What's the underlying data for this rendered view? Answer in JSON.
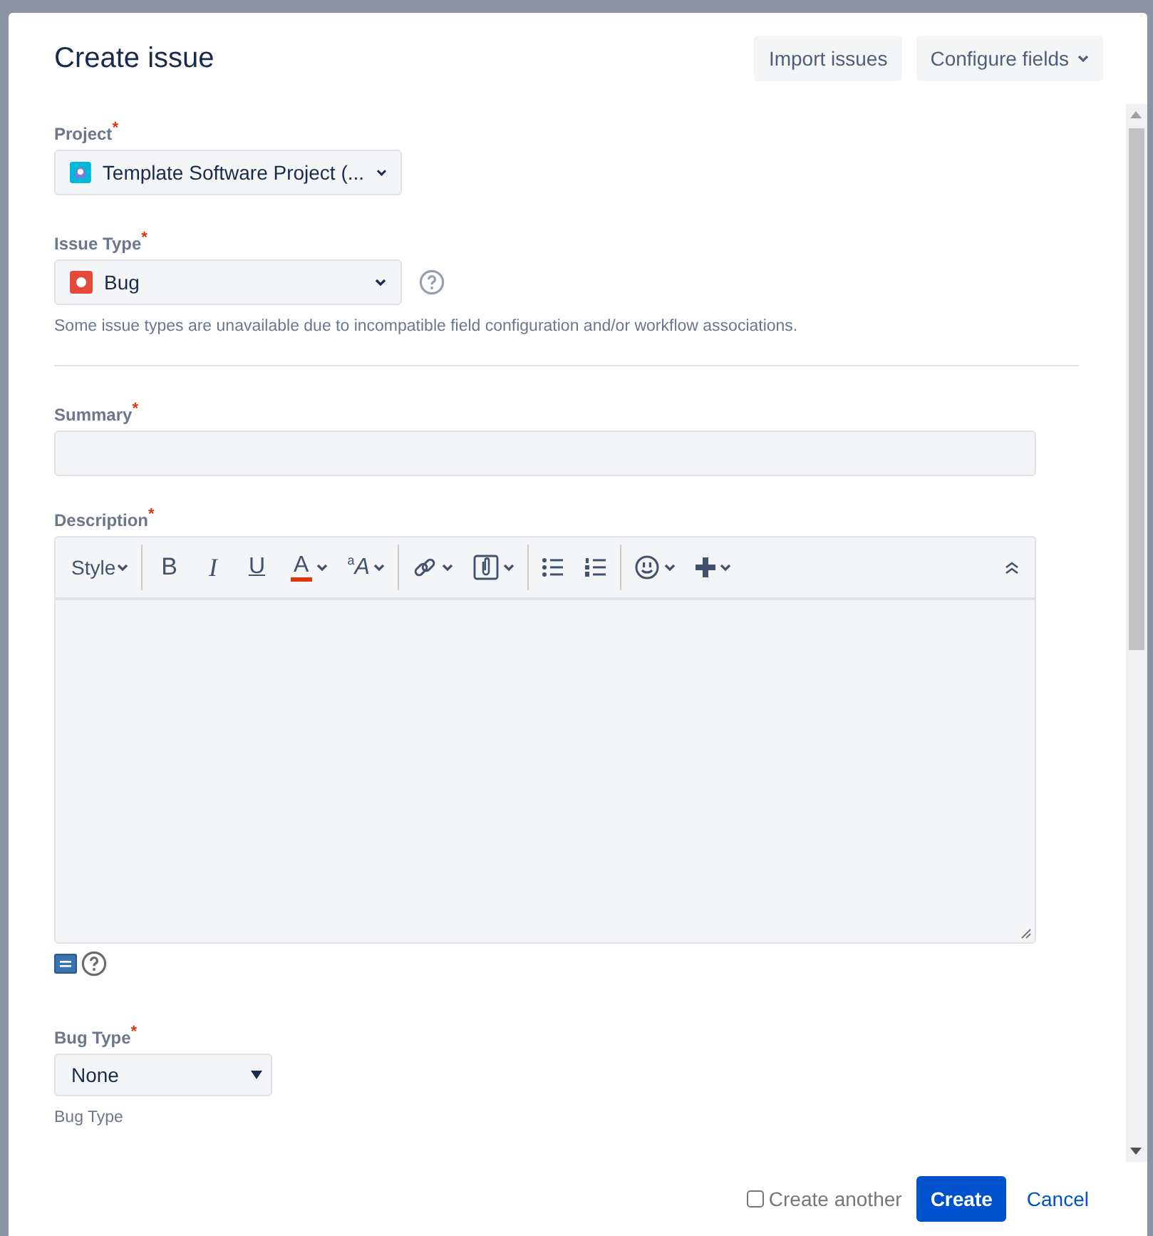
{
  "dialog": {
    "title": "Create issue"
  },
  "header_buttons": [
    {
      "label": "Import issues",
      "dropdown": false
    },
    {
      "label": "Configure fields",
      "dropdown": true
    }
  ],
  "fields": [
    {
      "kind": "project-select",
      "label": "Project",
      "required_mark": "*",
      "value": "Template Software Project (..."
    },
    {
      "kind": "type-select",
      "label": "Issue Type",
      "required_mark": "*",
      "value": "Bug",
      "help": true,
      "note": "Some issue types are unavailable due to incompatible field configuration and/or workflow associations.",
      "divider_after": true
    },
    {
      "kind": "text",
      "label": "Summary",
      "required_mark": "*"
    },
    {
      "kind": "editor",
      "label": "Description",
      "required_mark": "*",
      "toolbar": [
        [
          {
            "kind": "menu",
            "label": "Style",
            "dropdown": true
          }
        ],
        [
          {
            "kind": "bold",
            "label": "B",
            "dropdown": false
          },
          {
            "kind": "italic",
            "label": "I",
            "dropdown": false
          },
          {
            "kind": "underline",
            "label": "U",
            "dropdown": false
          },
          {
            "kind": "color",
            "label": "A",
            "dropdown": true
          },
          {
            "kind": "text-size",
            "label": "$^{a}$A",
            "dropdown": true
          }
        ],
        [
          {
            "kind": "link",
            "dropdown": true
          },
          {
            "kind": "attachment",
            "dropdown": true
          }
        ],
        [
          {
            "kind": "bullet-list",
            "dropdown": false
          },
          {
            "kind": "numbered-list",
            "dropdown": false
          }
        ],
        [
          {
            "kind": "emoticon",
            "dropdown": true
          },
          {
            "kind": "insert",
            "dropdown": true
          }
        ]
      ]
    },
    {
      "kind": "native-select",
      "label": "Bug Type",
      "required_mark": "*",
      "value": "None",
      "note": "Bug Type"
    }
  ],
  "footer": {
    "create_another": {
      "label": "Create another",
      "checked": false
    },
    "buttons": [
      {
        "kind": "primary",
        "label": "Create"
      },
      {
        "kind": "link",
        "label": "Cancel"
      }
    ]
  }
}
